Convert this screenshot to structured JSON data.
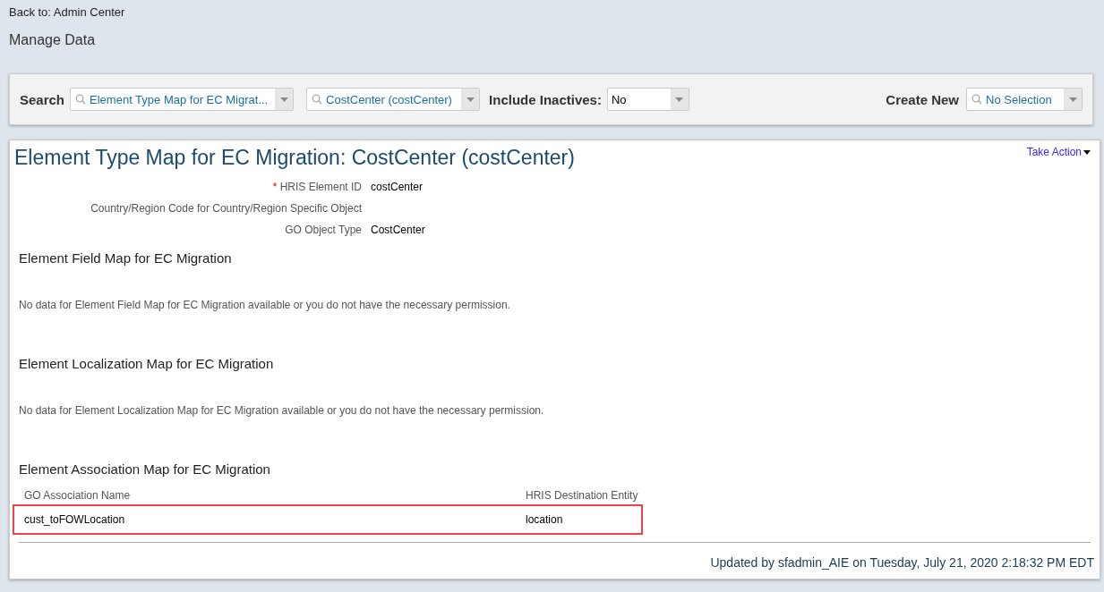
{
  "back_link": "Back to: Admin Center",
  "page_title": "Manage Data",
  "search_bar": {
    "search_label": "Search",
    "fields": [
      {
        "kind": "search",
        "value": "Element Type Map for EC Migrat..."
      },
      {
        "kind": "search",
        "value": "CostCenter (costCenter)"
      }
    ],
    "inactives_label": "Include Inactives:",
    "inactives_field": {
      "kind": "select",
      "value": "No"
    },
    "create_label": "Create New",
    "create_field": {
      "kind": "search",
      "value": "No Selection"
    }
  },
  "record": {
    "title": "Element Type Map for EC Migration: CostCenter (costCenter)",
    "take_action": "Take Action",
    "fields": [
      {
        "required_mark": "*",
        "label": "HRIS Element ID",
        "value": "costCenter"
      },
      {
        "label": "Country/Region Code for Country/Region Specific Object"
      },
      {
        "label": "GO Object Type",
        "value": "CostCenter"
      }
    ],
    "sections": [
      {
        "kind": "empty",
        "title": "Element Field Map for EC Migration",
        "message": "No data for Element Field Map for EC Migration available or you do not have the necessary permission."
      },
      {
        "kind": "empty",
        "title": "Element Localization Map for EC Migration",
        "message": "No data for Element Localization Map for EC Migration available or you do not have the necessary permission."
      },
      {
        "kind": "table",
        "title": "Element Association Map for EC Migration",
        "columns": [
          "GO Association Name",
          "HRIS Destination Entity"
        ],
        "rows": [
          {
            "highlighted": true,
            "cells": [
              "cust_toFOWLocation",
              "location"
            ]
          }
        ]
      }
    ],
    "updated": "Updated by sfadmin_AIE on Tuesday, July 21, 2020 2:18:32 PM EDT"
  }
}
